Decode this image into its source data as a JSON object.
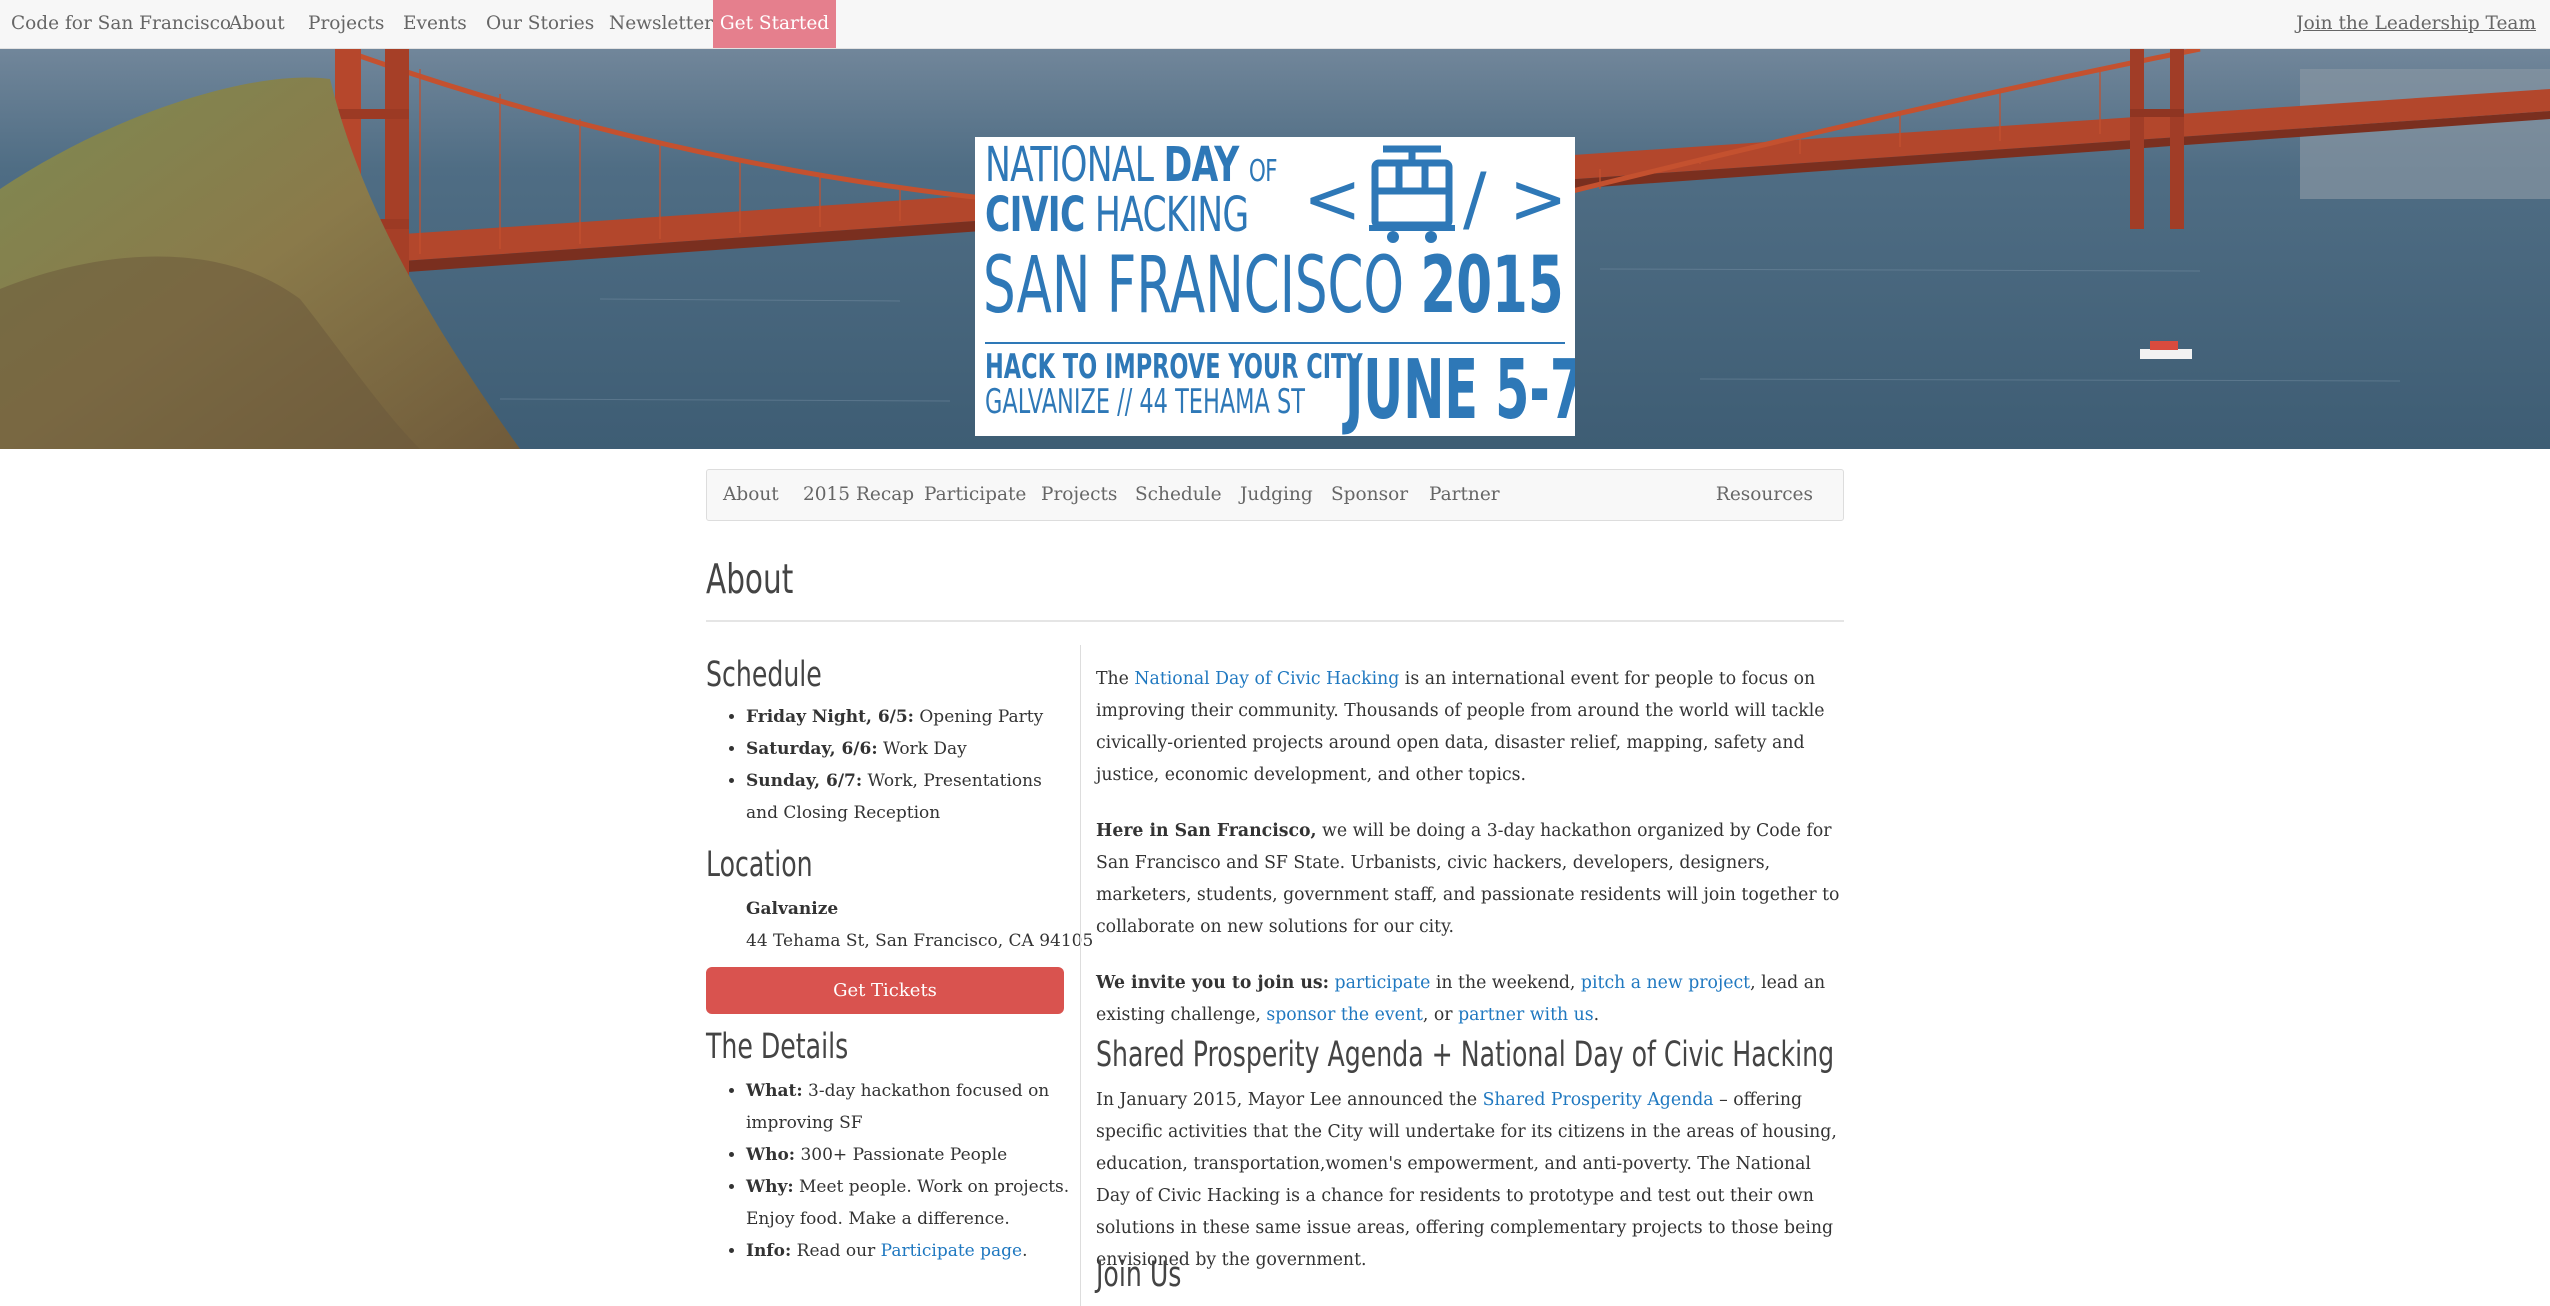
{
  "topbar": {
    "brand": "Code for San Francisco",
    "items": [
      "About",
      "Projects",
      "Events",
      "Our Stories",
      "Newsletter"
    ],
    "cta": "Get Started",
    "leadership": "Join the Leadership Team",
    "cta_color": "#e57f8d"
  },
  "poster": {
    "line1_national": "NATIONAL",
    "line1_day": "DAY",
    "line1_of": "OF",
    "line2_civic": "CIVIC",
    "line2_hacking": "HACKING",
    "city": "SAN FRANCISCO",
    "year": "2015",
    "tagline": "HACK TO IMPROVE YOUR CITY",
    "venue": "GALVANIZE // 44 TEHAMA ST",
    "dates": "JUNE 5-7",
    "code_open": "<",
    "code_close": "/ >",
    "icon": "cable-car-icon",
    "color": "#2e78b7"
  },
  "subnav": {
    "items": [
      "About",
      "2015 Recap",
      "Participate",
      "Projects",
      "Schedule",
      "Judging",
      "Sponsor",
      "Partner"
    ],
    "right": "Resources"
  },
  "about": {
    "title": "About"
  },
  "schedule": {
    "title": "Schedule",
    "items": [
      {
        "label": "Friday Night, 6/5:",
        "text": " Opening Party"
      },
      {
        "label": "Saturday, 6/6:",
        "text": " Work Day"
      },
      {
        "label": "Sunday, 6/7:",
        "text": " Work, Presentations and Closing Reception"
      }
    ]
  },
  "location": {
    "title": "Location",
    "name": "Galvanize",
    "address": "44 Tehama St, San Francisco, CA 94105",
    "button": "Get Tickets",
    "button_color": "#d9534f"
  },
  "details": {
    "title": "The Details",
    "items": [
      {
        "label": "What:",
        "text": " 3-day hackathon focused on improving SF"
      },
      {
        "label": "Who:",
        "text": " 300+ Passionate People"
      },
      {
        "label": "Why:",
        "text": " Meet people. Work on projects. Enjoy food. Make a difference."
      },
      {
        "label": "Info:",
        "text": " Read our ",
        "link": "Participate page",
        "after": "."
      }
    ]
  },
  "intro": {
    "p1_before": "The ",
    "p1_link": "National Day of Civic Hacking",
    "p1_after": " is an international event for people to focus on improving their community. Thousands of people from around the world will tackle civically-oriented projects around open data, disaster relief, mapping, safety and justice, economic development, and other topics.",
    "p2_bold": "Here in San Francisco,",
    "p2_text": " we will be doing a 3-day hackathon organized by Code for San Francisco and SF State. Urbanists, civic hackers, developers, designers, marketers, students, government staff, and passionate residents will join together to collaborate on new solutions for our city.",
    "p3_bold": "We invite you to join us:",
    "p3_s1": " ",
    "p3_link1": "participate",
    "p3_s2": " in the weekend, ",
    "p3_link2": "pitch a new project",
    "p3_s3": ", lead an existing challenge, ",
    "p3_link3": "sponsor the event",
    "p3_s4": ", or ",
    "p3_link4": "partner with us",
    "p3_s5": "."
  },
  "agenda": {
    "title": "Shared Prosperity Agenda + National Day of Civic Hacking",
    "before": "In January 2015, Mayor Lee announced the ",
    "link": "Shared Prosperity Agenda",
    "after": " – offering specific activities that the City will undertake for its citizens in the areas of housing, education, transportation,women's empowerment, and anti-poverty. The National Day of Civic Hacking is a chance for residents to prototype and test out their own solutions in these same issue areas, offering complementary projects to those being envisioned by the government."
  },
  "join": {
    "title": "Join Us"
  }
}
